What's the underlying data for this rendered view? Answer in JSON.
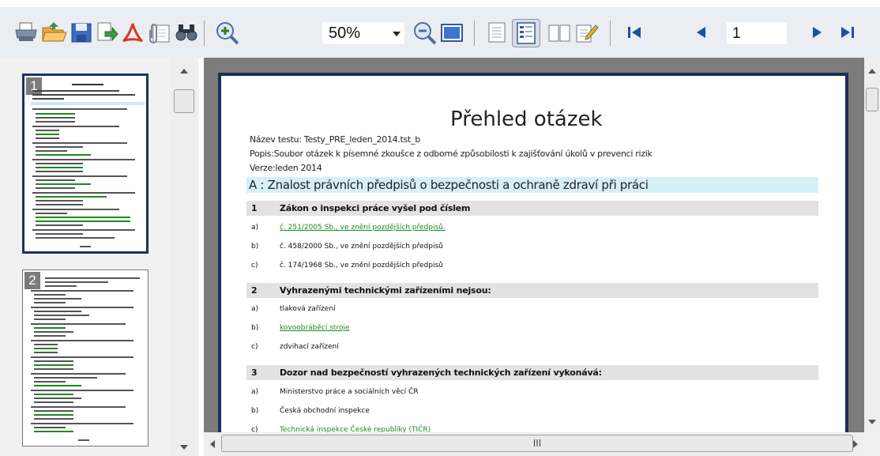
{
  "toolbar": {
    "zoom_value": "50%",
    "page_number": "1",
    "icons": [
      "print-icon",
      "open-icon",
      "save-icon",
      "export-icon",
      "pdf-icon",
      "attach-icon",
      "find-icon",
      "zoom-in-icon",
      "zoom-out-icon",
      "page-view-icon",
      "single-page-icon",
      "multi-page-icon",
      "book-view-icon",
      "edit-icon",
      "first-page-icon",
      "previous-page-icon",
      "next-page-icon",
      "last-page-icon"
    ]
  },
  "thumbnails": [
    {
      "number": "1"
    },
    {
      "number": "2"
    }
  ],
  "document": {
    "title": "Přehled otázek",
    "test_name": "Název testu: Testy_PRE_leden_2014.tst_b",
    "description": "Popis:Soubor otázek k písemné zkoušce z odborné způsobilosti k zajišťování úkolů v prevenci rizik",
    "version": "Verze:leden 2014",
    "section": "A : Znalost právních předpisů o bezpečnosti a ochraně zdraví při práci",
    "questions": [
      {
        "number": "1",
        "text": "Zákon o inspekci práce vyšel pod číslem",
        "answers": [
          {
            "letter": "a)",
            "text": "č. 251/2005 Sb., ve znění pozdějších předpisů.",
            "correct": true
          },
          {
            "letter": "b)",
            "text": "č. 458/2000 Sb., ve znění pozdějších předpisů",
            "correct": false
          },
          {
            "letter": "c)",
            "text": "č. 174/1968 Sb., ve znění pozdějších předpisů",
            "correct": false
          }
        ]
      },
      {
        "number": "2",
        "text": "Vyhrazenými technickými zařízeními nejsou:",
        "answers": [
          {
            "letter": "a)",
            "text": "tlaková zařízení",
            "correct": false
          },
          {
            "letter": "b)",
            "text": "kovoobráběcí stroje",
            "correct": true
          },
          {
            "letter": "c)",
            "text": "zdvihací zařízení",
            "correct": false
          }
        ]
      },
      {
        "number": "3",
        "text": "Dozor nad bezpečností vyhrazených technických zařízení vykonává:",
        "answers": [
          {
            "letter": "a)",
            "text": "Ministerstvo práce a sociálních věcí ČR",
            "correct": false
          },
          {
            "letter": "b)",
            "text": "Česká obchodní inspekce",
            "correct": false
          },
          {
            "letter": "c)",
            "text": "Technická inspekce České republiky (TIČR)",
            "correct": true
          }
        ]
      }
    ]
  },
  "scrollbar": {
    "h_grip": "III"
  },
  "colors": {
    "correct_answer": "#1d8a1d",
    "section_bg": "#d6eff8",
    "question_bg": "#e2e2e2",
    "page_border": "#1e2e5a"
  }
}
